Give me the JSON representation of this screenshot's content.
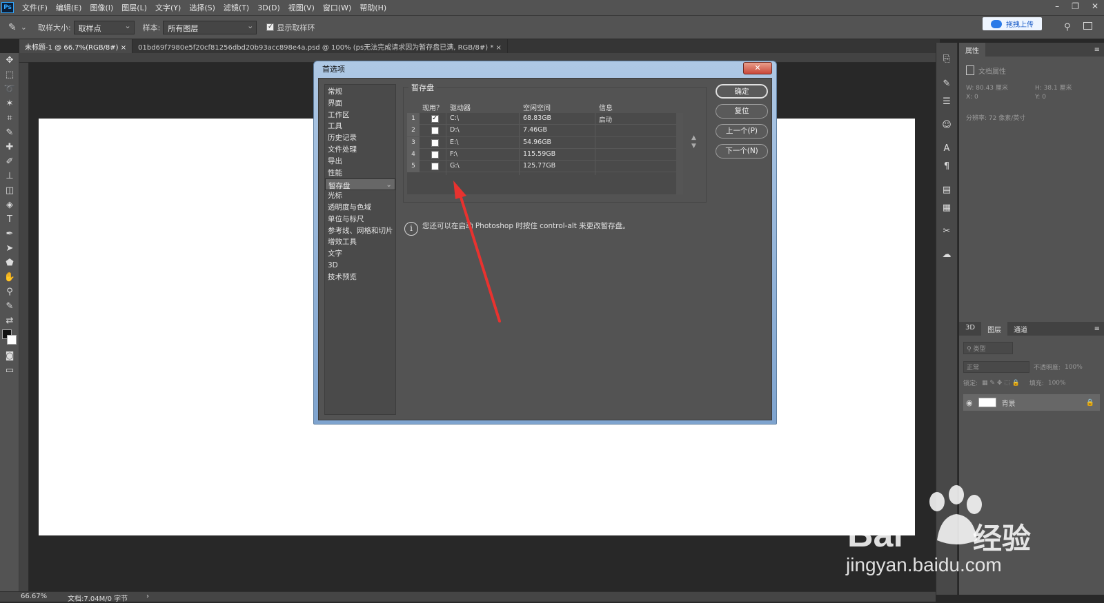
{
  "app": {
    "logo": "Ps"
  },
  "menu": [
    "文件(F)",
    "编辑(E)",
    "图像(I)",
    "图层(L)",
    "文字(Y)",
    "选择(S)",
    "滤镜(T)",
    "3D(D)",
    "视图(V)",
    "窗口(W)",
    "帮助(H)"
  ],
  "options": {
    "sample_size_label": "取样大小:",
    "sample_size_value": "取样点",
    "sample_label": "样本:",
    "sample_value": "所有图层",
    "show_ring_label": "显示取样环"
  },
  "cloud": {
    "label": "拖拽上传"
  },
  "tabs": [
    {
      "label": "未标题-1 @ 66.7%(RGB/8#)"
    },
    {
      "label": "01bd69f7980e5f20cf81256dbd20b93acc898e4a.psd @ 100% (ps无法完成请求因为暂存盘已满, RGB/8#) *"
    }
  ],
  "status": {
    "zoom": "66.67%",
    "doc": "文档:7.04M/0 字节"
  },
  "properties": {
    "tab": "属性",
    "doc_props": "文档属性",
    "w": "W:  80.43 厘米",
    "h": "H:  38.1 厘米",
    "x": "X:  0",
    "y": "Y:  0",
    "res": "分辨率: 72 像素/英寸"
  },
  "layers": {
    "tabs": [
      "3D",
      "图层",
      "通道"
    ],
    "filter": "类型",
    "blend": "正常",
    "opacity_label": "不透明度:",
    "opacity": "100%",
    "lock_label": "锁定:",
    "fill_label": "填充:",
    "fill": "100%",
    "layer_name": "背景"
  },
  "dialog": {
    "title": "首选项",
    "close": "✕",
    "categories": [
      "常规",
      "界面",
      "工作区",
      "工具",
      "历史记录",
      "文件处理",
      "导出",
      "性能",
      "暂存盘",
      "光标",
      "透明度与色域",
      "单位与标尺",
      "参考线、网格和切片",
      "增效工具",
      "文字",
      "3D",
      "技术预览"
    ],
    "selected_category": "暂存盘",
    "group_title": "暂存盘",
    "headers": {
      "active": "现用？",
      "drive": "驱动器",
      "free": "空闲空间",
      "info": "信息"
    },
    "drives": [
      {
        "n": "1",
        "checked": true,
        "drive": "C:\\",
        "free": "68.83GB",
        "info": "启动"
      },
      {
        "n": "2",
        "checked": false,
        "drive": "D:\\",
        "free": "7.46GB",
        "info": ""
      },
      {
        "n": "3",
        "checked": false,
        "drive": "E:\\",
        "free": "54.96GB",
        "info": ""
      },
      {
        "n": "4",
        "checked": false,
        "drive": "F:\\",
        "free": "115.59GB",
        "info": ""
      },
      {
        "n": "5",
        "checked": false,
        "drive": "G:\\",
        "free": "125.77GB",
        "info": ""
      }
    ],
    "buttons": {
      "ok": "确定",
      "reset": "复位",
      "prev": "上一个(P)",
      "next": "下一个(N)"
    },
    "hint": "您还可以在启动 Photoshop 时按住 control-alt 来更改暂存盘。"
  },
  "watermark": {
    "brand": "Bai",
    "brand2": "经验",
    "url": "jingyan.baidu.com"
  },
  "colors": {
    "accent": "#31a8ff",
    "arrow": "#e8322f"
  }
}
